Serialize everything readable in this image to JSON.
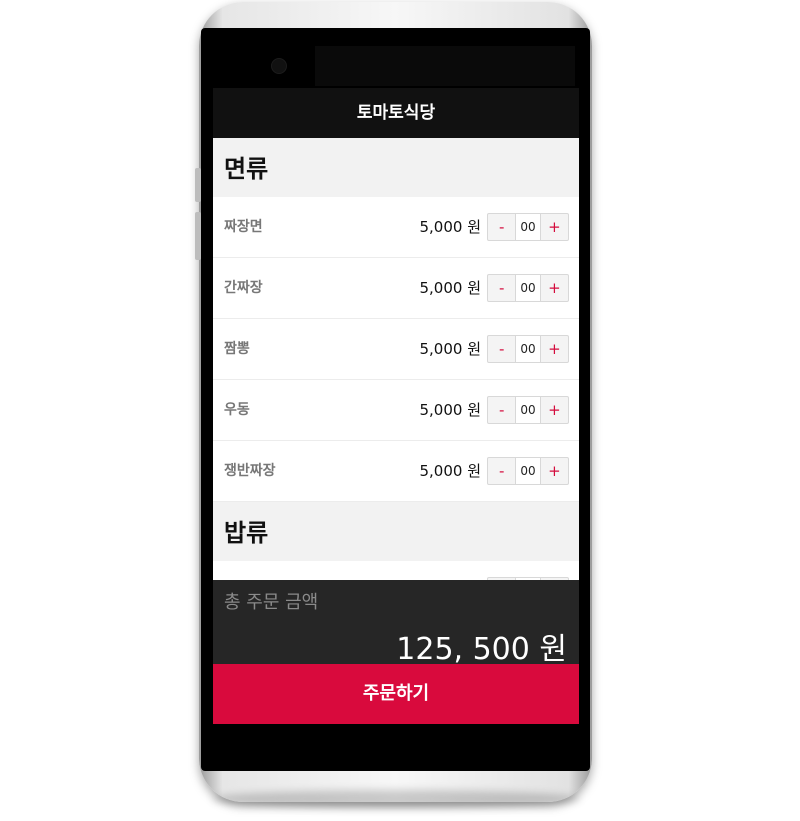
{
  "app": {
    "title": "토마토식당"
  },
  "sections": [
    {
      "title": "면류",
      "items": [
        {
          "name": "짜장면",
          "price": "5,000 원",
          "qty": "00"
        },
        {
          "name": "간짜장",
          "price": "5,000 원",
          "qty": "00"
        },
        {
          "name": "짬뽕",
          "price": "5,000 원",
          "qty": "00"
        },
        {
          "name": "우동",
          "price": "5,000 원",
          "qty": "00"
        },
        {
          "name": "쟁반짜장",
          "price": "5,000 원",
          "qty": "00"
        }
      ]
    },
    {
      "title": "밥류",
      "items": [
        {
          "name": "",
          "price": "",
          "qty": ""
        }
      ]
    }
  ],
  "stepper": {
    "minus": "-",
    "plus": "+"
  },
  "total": {
    "label": "총 주문 금액",
    "amount": "125, 500 원"
  },
  "order_button": {
    "label": "주문하기"
  },
  "colors": {
    "accent": "#d90a3d",
    "header_bg": "#111111",
    "total_bg": "#262626"
  }
}
